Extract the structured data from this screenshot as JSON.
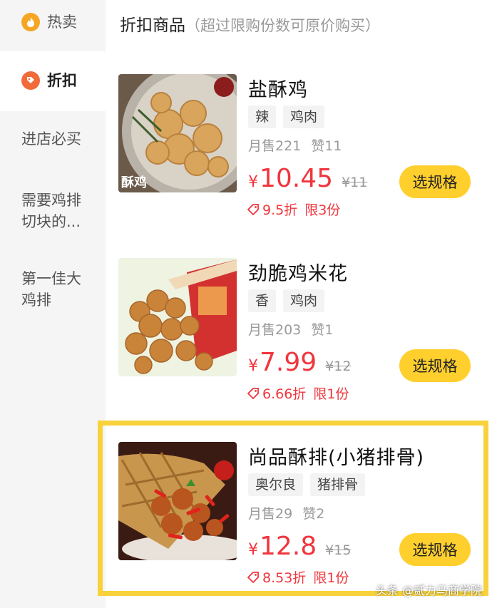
{
  "sidebar": {
    "items": [
      {
        "label": "热卖",
        "icon": "fire-icon"
      },
      {
        "label": "折扣",
        "icon": "discount-icon"
      },
      {
        "label": "进店必买"
      },
      {
        "label_line1": "需要鸡排",
        "label_line2": "切块的..."
      },
      {
        "label_line1": "第一佳大",
        "label_line2": "鸡排"
      }
    ]
  },
  "section": {
    "title": "折扣商品",
    "note": "（超过限购份数可原价购买）"
  },
  "products": [
    {
      "name": "盐酥鸡",
      "tags": [
        "辣",
        "鸡肉"
      ],
      "sold": "月售221",
      "likes": "赞11",
      "currency": "¥",
      "price": "10.45",
      "original": "¥11",
      "discount": "9.5折",
      "limit": "限3份",
      "button": "选规格",
      "image_text": "酥鸡"
    },
    {
      "name": "劲脆鸡米花",
      "tags": [
        "香",
        "鸡肉"
      ],
      "sold": "月售203",
      "likes": "赞1",
      "currency": "¥",
      "price": "7.99",
      "original": "¥12",
      "discount": "6.66折",
      "limit": "限1份",
      "button": "选规格"
    },
    {
      "name": "尚品酥排(小猪排骨)",
      "tags": [
        "奥尔良",
        "猪排骨"
      ],
      "sold": "月售29",
      "likes": "赞2",
      "currency": "¥",
      "price": "12.8",
      "original": "¥15",
      "discount": "8.53折",
      "limit": "限1份",
      "button": "选规格"
    }
  ],
  "watermark": "头条 @贰力马商学院",
  "colors": {
    "accent_yellow": "#ffcf2e",
    "price_red": "#f0353d",
    "highlight_border": "#f7d23a",
    "sidebar_bg": "#f5f5f5"
  }
}
